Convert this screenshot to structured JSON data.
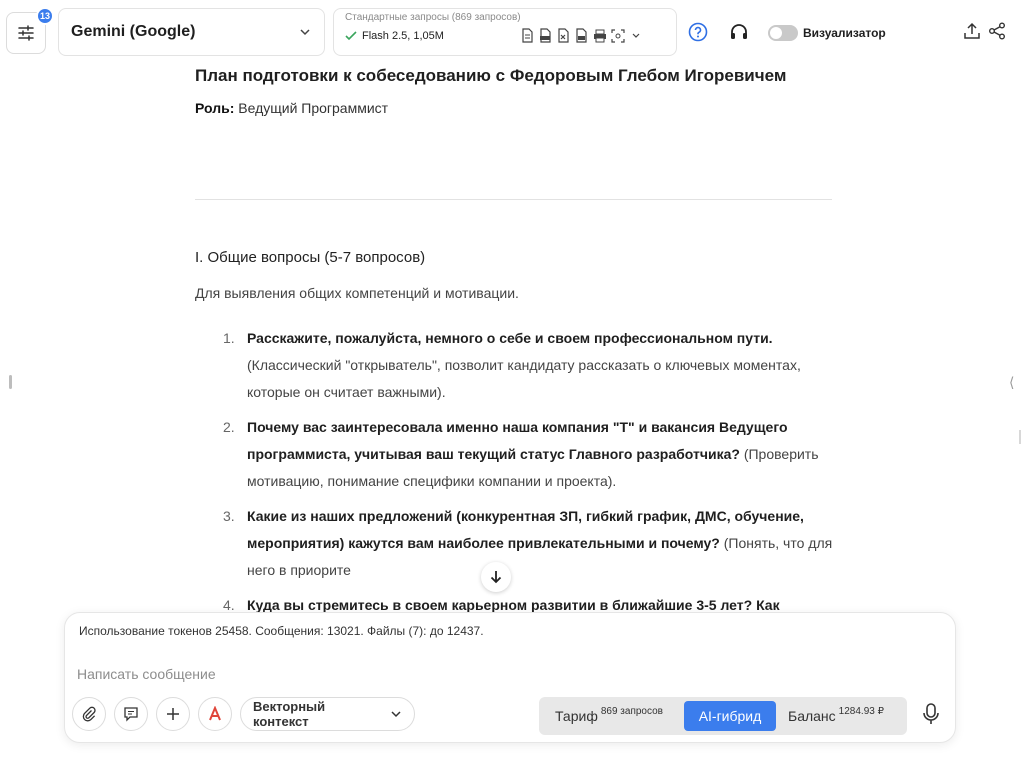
{
  "topbar": {
    "notification_count": "13",
    "model_name": "Gemini (Google)",
    "requests_title": "Стандартные запросы (869 запросов)",
    "requests_model": "Flash 2.5, 1,05M",
    "file_icons": [
      "doc-icon",
      "pdf-icon",
      "xls-icon",
      "txt-icon",
      "print-icon",
      "screenshot-icon"
    ],
    "visualizer_label": "Визуализатор",
    "visualizer_enabled": false
  },
  "document": {
    "title": "План подготовки к собеседованию с Федоровым Глебом Игоревичем",
    "role_label": "Роль:",
    "role_value": "Ведущий Программист",
    "section_title": "I. Общие вопросы (5-7 вопросов)",
    "section_desc": "Для выявления общих компетенций и мотивации.",
    "questions": [
      {
        "num": "1.",
        "question": "Расскажите, пожалуйста, немного о себе и своем профессиональном пути.",
        "note": "(Классический \"открыватель\", позволит кандидату рассказать о ключевых моментах, которые он считает важными)."
      },
      {
        "num": "2.",
        "question": "Почему вас заинтересовала именно наша компания \"Т\" и вакансия Ведущего программиста, учитывая ваш текущий статус Главного разработчика?",
        "note": "(Проверить мотивацию, понимание специфики компании и проекта)."
      },
      {
        "num": "3.",
        "question": "Какие из наших предложений (конкурентная ЗП, гибкий график, ДМС, обучение, мероприятия) кажутся вам наиболее привлекательными и почему?",
        "note": "(Понять, что для него в приорите"
      },
      {
        "num": "4.",
        "question": "Куда вы стремитесь в своем карьерном развитии в ближайшие 3-5 лет? Как",
        "note": ""
      }
    ]
  },
  "composer": {
    "usage_text": "Использование токенов 25458. Сообщения: 13021. Файлы (7): до 12437.",
    "placeholder": "Написать сообщение",
    "value": "",
    "vector_context_label": "Векторный контекст",
    "tariff_label": "Тариф",
    "tariff_sup": "869 запросов",
    "ai_hybrid_label": "AI-гибрид",
    "balance_label": "Баланс",
    "balance_sup": "1284.93 ₽"
  },
  "colors": {
    "accent": "#3b7ded",
    "badge": "#3b7ded",
    "text": "#1f1f1f",
    "muted": "#8a8a8a"
  }
}
